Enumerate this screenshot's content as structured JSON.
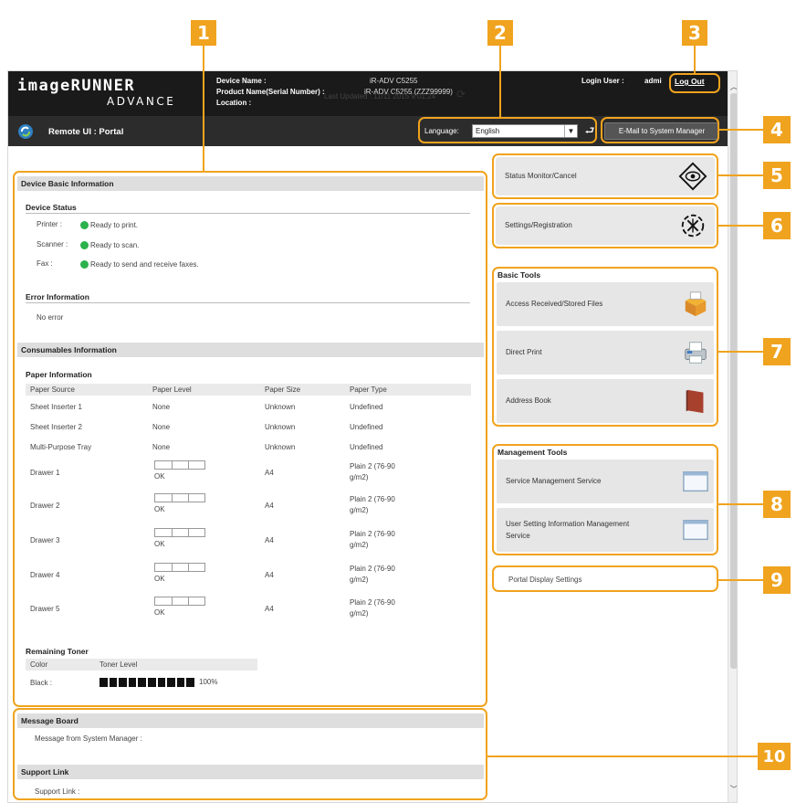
{
  "callouts": [
    "1",
    "2",
    "3",
    "4",
    "5",
    "6",
    "7",
    "8",
    "9",
    "10"
  ],
  "header": {
    "logo_line1": "imageRUNNER",
    "logo_line2": "ADVANCE",
    "device_name_label": "Device Name :",
    "device_name_value": "iR-ADV C5255",
    "product_label": "Product Name(Serial Number) :",
    "product_value": "iR-ADV C5255 (ZZZ99999)",
    "location_label": "Location :",
    "login_label": "Login User :",
    "login_value": "admi",
    "logout": "Log Out"
  },
  "subbar": {
    "title": "Remote UI : Portal",
    "language_label": "Language:",
    "language_value": "English",
    "mail_button": "E-Mail to System Manager"
  },
  "last_updated": "Last Updated : 11/11 2015 9:01:24",
  "device_basic_information": {
    "title": "Device Basic Information",
    "device_status_heading": "Device Status",
    "status": [
      {
        "label": "Printer :",
        "value": "Ready to print."
      },
      {
        "label": "Scanner :",
        "value": "Ready to scan."
      },
      {
        "label": "Fax :",
        "value": "Ready to send and receive faxes."
      }
    ],
    "error_heading": "Error Information",
    "error_value": "No error"
  },
  "consumables": {
    "title": "Consumables Information",
    "paper_heading": "Paper Information",
    "columns": [
      "Paper Source",
      "Paper Level",
      "Paper Size",
      "Paper Type"
    ],
    "rows": [
      {
        "source": "Sheet Inserter 1",
        "level": "None",
        "size": "Unknown",
        "type": "Undefined"
      },
      {
        "source": "Sheet Inserter 2",
        "level": "None",
        "size": "Unknown",
        "type": "Undefined"
      },
      {
        "source": "Multi-Purpose Tray",
        "level": "None",
        "size": "Unknown",
        "type": "Undefined"
      },
      {
        "source": "Drawer 1",
        "level": "OK",
        "size": "A4",
        "type1": "Plain 2 (76-90",
        "type2": "g/m2)"
      },
      {
        "source": "Drawer 2",
        "level": "OK",
        "size": "A4",
        "type1": "Plain 2 (76-90",
        "type2": "g/m2)"
      },
      {
        "source": "Drawer 3",
        "level": "OK",
        "size": "A4",
        "type1": "Plain 2 (76-90",
        "type2": "g/m2)"
      },
      {
        "source": "Drawer 4",
        "level": "OK",
        "size": "A4",
        "type1": "Plain 2 (76-90",
        "type2": "g/m2)"
      },
      {
        "source": "Drawer 5",
        "level": "OK",
        "size": "A4",
        "type1": "Plain 2 (76-90",
        "type2": "g/m2)"
      }
    ],
    "toner_heading": "Remaining Toner",
    "toner_columns": [
      "Color",
      "Toner Level"
    ],
    "toner_color": "Black :",
    "toner_level": "100%",
    "toner_fraction": 1.0
  },
  "message_board": {
    "title": "Message Board",
    "text": "Message from System Manager :"
  },
  "support_link": {
    "title": "Support Link",
    "text": "Support Link :"
  },
  "right": {
    "status_monitor": "Status Monitor/Cancel",
    "settings": "Settings/Registration",
    "basic_tools_title": "Basic Tools",
    "basic_tools": [
      "Access Received/Stored Files",
      "Direct Print",
      "Address Book"
    ],
    "management_tools_title": "Management Tools",
    "mgmt_tool_1": "Service Management Service",
    "mgmt_tool_2a": "User Setting Information Management",
    "mgmt_tool_2b": "Service",
    "portal_display": "Portal Display Settings"
  }
}
